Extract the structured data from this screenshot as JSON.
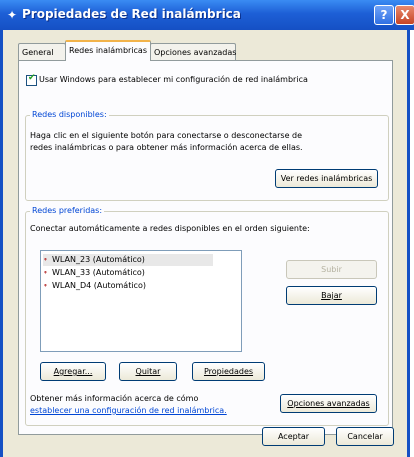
{
  "window": {
    "title": "Propiedades de Red inalámbrica",
    "help": "?",
    "close": "X"
  },
  "tabs": [
    {
      "label": "General"
    },
    {
      "label": "Redes inalámbricas"
    },
    {
      "label": "Opciones avanzadas"
    }
  ],
  "use_windows_checkbox": {
    "checked": true,
    "label": "Usar Windows para establecer mi configuración de red inalámbrica"
  },
  "available": {
    "legend": "Redes disponibles:",
    "line1": "Haga clic en el siguiente botón para conectarse o desconectarse de",
    "line2": "redes inalámbricas o para obtener más información acerca de ellas.",
    "button": "Ver redes inalámbricas"
  },
  "preferred": {
    "legend": "Redes preferidas:",
    "desc": "Conectar automáticamente a redes disponibles en el orden siguiente:",
    "items": [
      {
        "label": "WLAN_23 (Automático)"
      },
      {
        "label": "WLAN_33 (Automático)"
      },
      {
        "label": "WLAN_D4 (Automático)"
      }
    ],
    "up_button": "Subir",
    "down_button": "Bajar",
    "add_button": "Agregar...",
    "remove_button": "Quitar",
    "properties_button": "Propiedades"
  },
  "info": {
    "line1": "Obtener más información acerca de cómo",
    "link": "establecer una configuración de red inalámbrica.",
    "advanced_button": "Opciones avanzadas"
  },
  "footer": {
    "ok_button": "Aceptar",
    "cancel_button": "Cancelar"
  }
}
